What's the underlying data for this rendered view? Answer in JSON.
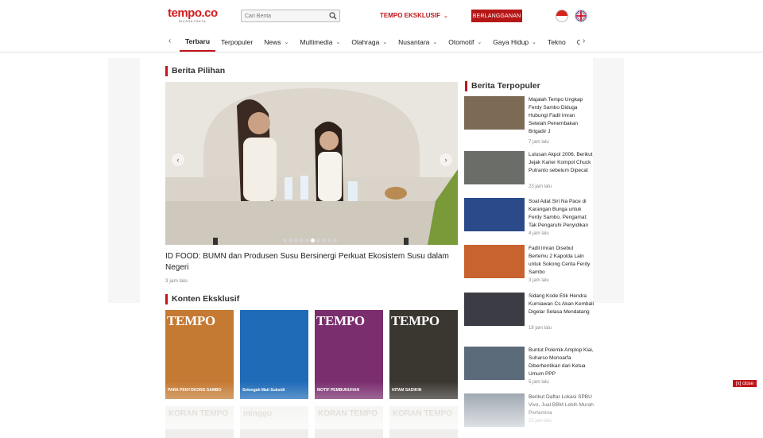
{
  "header": {
    "logo_text": "tempo.co",
    "logo_tagline": "BICARA FAKTA",
    "search_placeholder": "Cari Berita",
    "eksklusif_label": "TEMPO EKSKLUSIF",
    "subscribe_label": "BERLANGGANAN"
  },
  "nav": {
    "items": [
      {
        "label": "Terbaru",
        "dropdown": false,
        "active": true
      },
      {
        "label": "Terpopuler",
        "dropdown": false
      },
      {
        "label": "News",
        "dropdown": true
      },
      {
        "label": "Multimedia",
        "dropdown": true
      },
      {
        "label": "Olahraga",
        "dropdown": true
      },
      {
        "label": "Nusantara",
        "dropdown": true
      },
      {
        "label": "Otomotif",
        "dropdown": true
      },
      {
        "label": "Gaya Hidup",
        "dropdown": true
      },
      {
        "label": "Tekno",
        "dropdown": false
      },
      {
        "label": "Cantik",
        "dropdown": true
      },
      {
        "label": "C",
        "dropdown": false
      }
    ]
  },
  "berita_pilihan": {
    "section_title": "Berita Pilihan",
    "headline": "ID FOOD: BUMN dan Produsen Susu Bersinergi Perkuat Ekosistem Susu dalam Negeri",
    "time": "3 jam lalu",
    "carousel_slides": 10,
    "carousel_active": 5
  },
  "konten_eksklusif": {
    "section_title": "Konten Eksklusif",
    "covers": [
      {
        "masthead": "TEMPO",
        "caption": "PARA PENYOKONG SAMBO",
        "bg": "#c47a33"
      },
      {
        "masthead": "",
        "caption": "Setengah Mati Subsidi",
        "bg": "#1f6bb8"
      },
      {
        "masthead": "TEMPO",
        "caption": "MOTIF PEMBUNUHAN",
        "bg": "#7a2e6e"
      },
      {
        "masthead": "TEMPO",
        "caption": "HITAM SADIKIN",
        "bg": "#3a3630"
      }
    ],
    "row2": [
      "KORAN TEMPO",
      "minggu",
      "KORAN TEMPO",
      "KORAN TEMPO"
    ]
  },
  "terpopuler": {
    "section_title": "Berita Terpopuler",
    "items": [
      {
        "title": "Majalah Tempo Ungkap Ferdy Sambo Diduga Hubungi Fadil Imran Setelah Penembakan Brigadir J",
        "time": "7 jam lalu",
        "thumb": "#7d6a55"
      },
      {
        "title": "Lulusan Akpol 2006, Berikut Jejak Karier Kompol Chuck Putranto sebelum Dipecat",
        "time": "23 jam lalu",
        "thumb": "#6b6e68"
      },
      {
        "title": "Soal Adat Siri Na Pace di Karangan Bunga untuk Ferdy Sambo, Pengamat: Tak Pengaruhi Penyidikan",
        "time": "4 jam lalu",
        "thumb": "#2a4a8a"
      },
      {
        "title": "Fadil Imran Disebut Bertemu 2 Kapolda Lain untuk Sokong Cerita Ferdy Sambo",
        "time": "3 jam lalu",
        "thumb": "#c8622e"
      },
      {
        "title": "Sidang Kode Etik Hendra Kurniawan Cs Akan Kembali Digelar Selasa Mendatang",
        "time": "18 jam lalu",
        "thumb": "#3c3c44"
      },
      {
        "title": "Buntut Polemik Amplop Kiai, Suharso Monoarfa Diberhentikan dari Ketua Umum PPP",
        "time": "5 jam lalu",
        "thumb": "#5c6b7a"
      },
      {
        "title": "Berikut Daftar Lokasi SPBU Vivo, Jual BBM Lebih Murah Pertamina",
        "time": "22 jam lalu",
        "thumb": "#8a95a0"
      }
    ]
  },
  "ad": {
    "close_label": "[x] close"
  },
  "colors": {
    "brand_red": "#c0161c",
    "subscribe_bg": "#b51717"
  }
}
